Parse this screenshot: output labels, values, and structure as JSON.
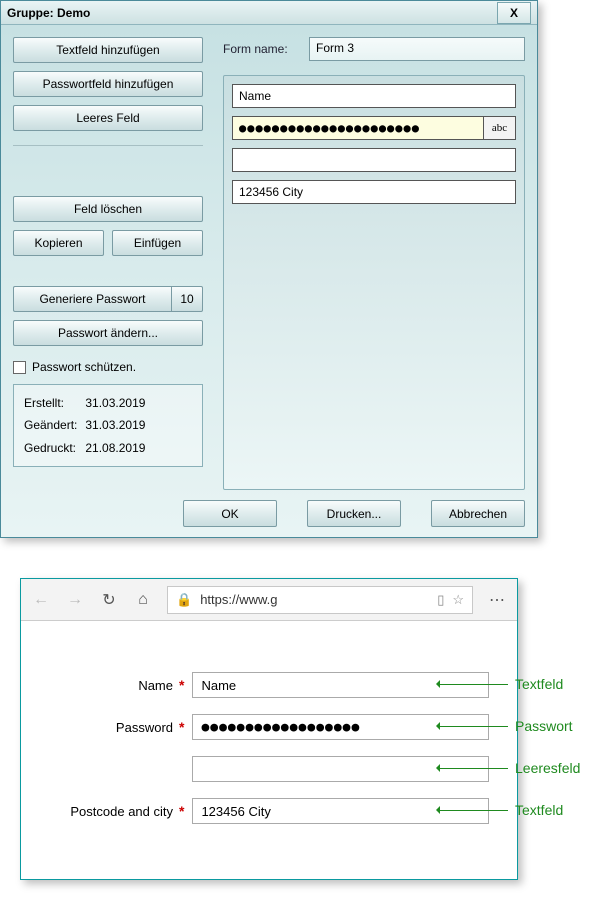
{
  "dialog": {
    "title": "Gruppe: Demo",
    "close": "X",
    "sidebar": {
      "add_text": "Textfeld hinzufügen",
      "add_password": "Passwortfeld hinzufügen",
      "empty_field": "Leeres Feld",
      "delete_field": "Feld löschen",
      "copy": "Kopieren",
      "paste": "Einfügen",
      "generate_pw": "Generiere Passwort",
      "pw_length": "10",
      "change_pw": "Passwort ändern...",
      "protect_pw": "Passwort schützen."
    },
    "meta": {
      "created_label": "Erstellt:",
      "created_value": "31.03.2019",
      "changed_label": "Geändert:",
      "changed_value": "31.03.2019",
      "printed_label": "Gedruckt:",
      "printed_value": "21.08.2019"
    },
    "form_name_label": "Form name:",
    "form_name_value": "Form 3",
    "fields": {
      "f1": "Name",
      "f2_masked": "●●●●●●●●●●●●●●●●●●●●●●",
      "f2_toggle": "abc",
      "f3": "",
      "f4": "123456 City"
    },
    "buttons": {
      "ok": "OK",
      "print": "Drucken...",
      "cancel": "Abbrechen"
    }
  },
  "browser": {
    "url": "https://www.g",
    "labels": {
      "name": "Name",
      "password": "Password",
      "postcode_city": "Postcode and city"
    },
    "values": {
      "name": "Name",
      "password": "●●●●●●●●●●●●●●●●●●",
      "empty": "",
      "postcode_city": "123456 City"
    }
  },
  "annotations": {
    "textfield": "Textfeld",
    "password": "Passwort",
    "emptyfield": "Leeresfeld"
  }
}
